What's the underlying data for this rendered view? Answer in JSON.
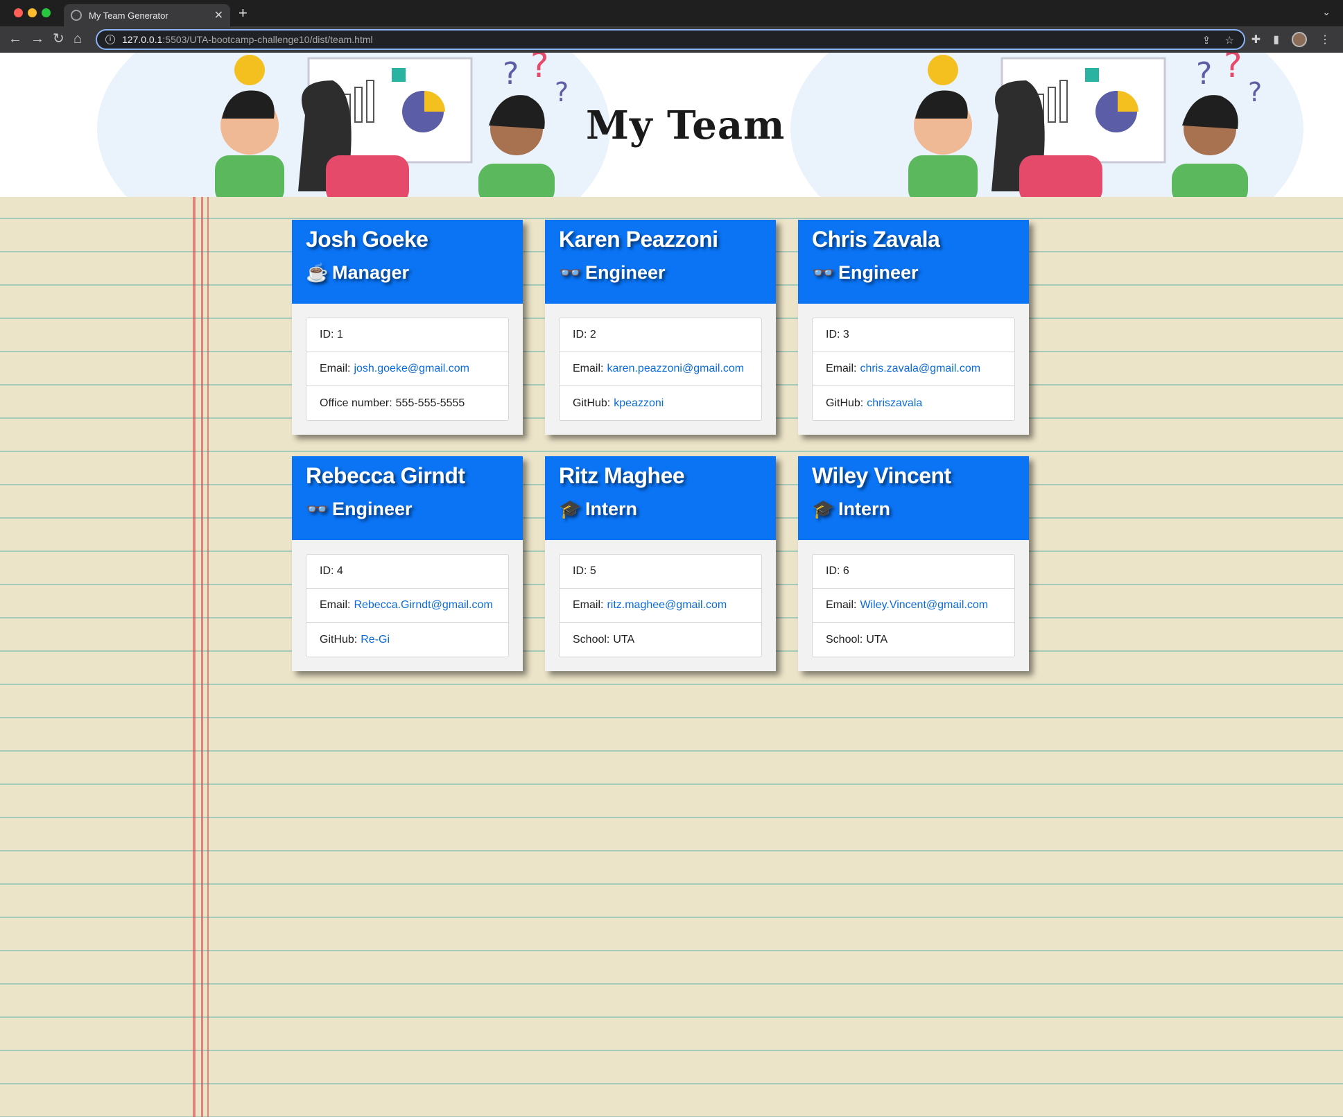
{
  "browser": {
    "tab_title": "My Team Generator",
    "url_host": "127.0.0.1",
    "url_rest": ":5503/UTA-bootcamp-challenge10/dist/team.html"
  },
  "page": {
    "title": "My Team"
  },
  "team": [
    {
      "name": "Josh Goeke",
      "role": "Manager",
      "role_icon": "coffee-icon",
      "id_label": "ID: 1",
      "email_label": "Email:",
      "email": "josh.goeke@gmail.com",
      "extra_label": "Office number:",
      "extra_value": "555-555-5555",
      "extra_is_link": false
    },
    {
      "name": "Karen Peazzoni",
      "role": "Engineer",
      "role_icon": "glasses-icon",
      "id_label": "ID: 2",
      "email_label": "Email:",
      "email": "karen.peazzoni@gmail.com",
      "extra_label": "GitHub:",
      "extra_value": "kpeazzoni",
      "extra_is_link": true
    },
    {
      "name": "Chris Zavala",
      "role": "Engineer",
      "role_icon": "glasses-icon",
      "id_label": "ID: 3",
      "email_label": "Email:",
      "email": "chris.zavala@gmail.com",
      "extra_label": "GitHub:",
      "extra_value": "chriszavala",
      "extra_is_link": true
    },
    {
      "name": "Rebecca Girndt",
      "role": "Engineer",
      "role_icon": "glasses-icon",
      "id_label": "ID: 4",
      "email_label": "Email:",
      "email": "Rebecca.Girndt@gmail.com",
      "extra_label": "GitHub:",
      "extra_value": "Re-Gi",
      "extra_is_link": true
    },
    {
      "name": "Ritz Maghee",
      "role": "Intern",
      "role_icon": "graduate-icon",
      "id_label": "ID: 5",
      "email_label": "Email:",
      "email": "ritz.maghee@gmail.com",
      "extra_label": "School:",
      "extra_value": "UTA",
      "extra_is_link": false
    },
    {
      "name": "Wiley Vincent",
      "role": "Intern",
      "role_icon": "graduate-icon",
      "id_label": "ID: 6",
      "email_label": "Email:",
      "email": "Wiley.Vincent@gmail.com",
      "extra_label": "School:",
      "extra_value": "UTA",
      "extra_is_link": false
    }
  ],
  "colors": {
    "card_header": "#0a74f5",
    "link": "#0b6bdb",
    "paper": "#ece4c8"
  }
}
